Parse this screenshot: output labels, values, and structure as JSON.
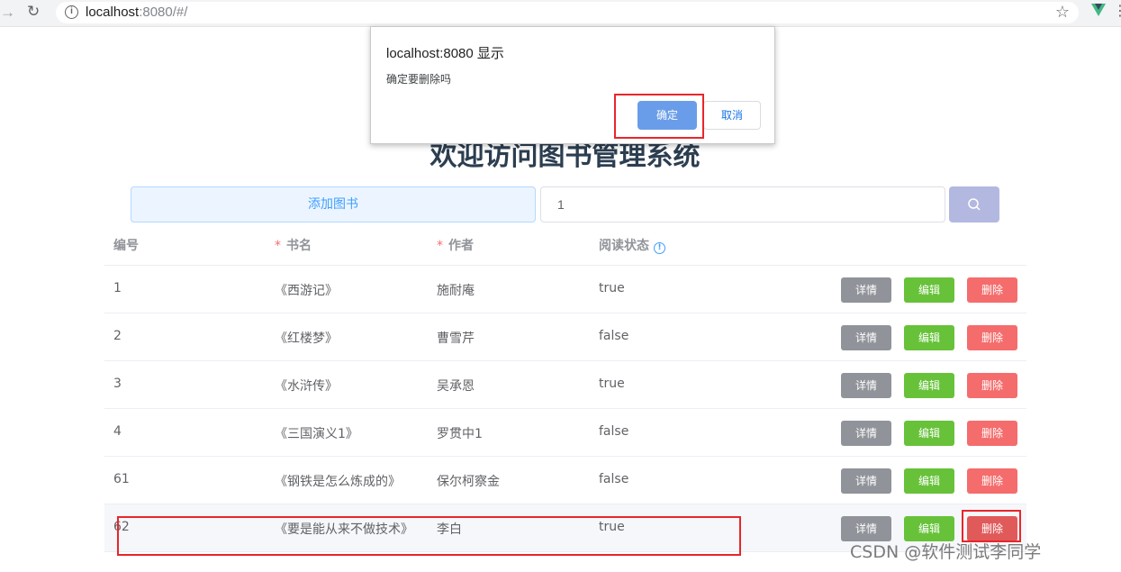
{
  "browser": {
    "url_host": "localhost",
    "url_rest": ":8080/#/",
    "back_icon": "arrow-right-icon",
    "reload_icon": "reload-icon"
  },
  "page": {
    "title": "欢迎访问图书管理系统",
    "add_button": "添加图书",
    "search_value": "1"
  },
  "table": {
    "headers": {
      "id": "编号",
      "name": "书名",
      "author": "作者",
      "status": "阅读状态"
    },
    "required_mark": "*",
    "help_glyph": "!",
    "actions": {
      "detail": "详情",
      "edit": "编辑",
      "delete": "删除"
    },
    "rows": [
      {
        "id": "1",
        "name": "《西游记》",
        "author": "施耐庵",
        "status": "true"
      },
      {
        "id": "2",
        "name": "《红楼梦》",
        "author": "曹雪芹",
        "status": "false"
      },
      {
        "id": "3",
        "name": "《水浒传》",
        "author": "吴承恩",
        "status": "true"
      },
      {
        "id": "4",
        "name": "《三国演义1》",
        "author": "罗贯中1",
        "status": "false"
      },
      {
        "id": "61",
        "name": "《钢铁是怎么炼成的》",
        "author": "保尔柯察金",
        "status": "false"
      },
      {
        "id": "62",
        "name": "《要是能从来不做技术》",
        "author": "李白",
        "status": "true"
      }
    ]
  },
  "dialog": {
    "title": "localhost:8080 显示",
    "message": "确定要删除吗",
    "ok": "确定",
    "cancel": "取消"
  },
  "watermark": "CSDN @软件测试李同学",
  "colors": {
    "primary": "#409eff",
    "success": "#67c23a",
    "danger": "#f56c6c",
    "info": "#909399",
    "annotation": "#e8262b"
  }
}
